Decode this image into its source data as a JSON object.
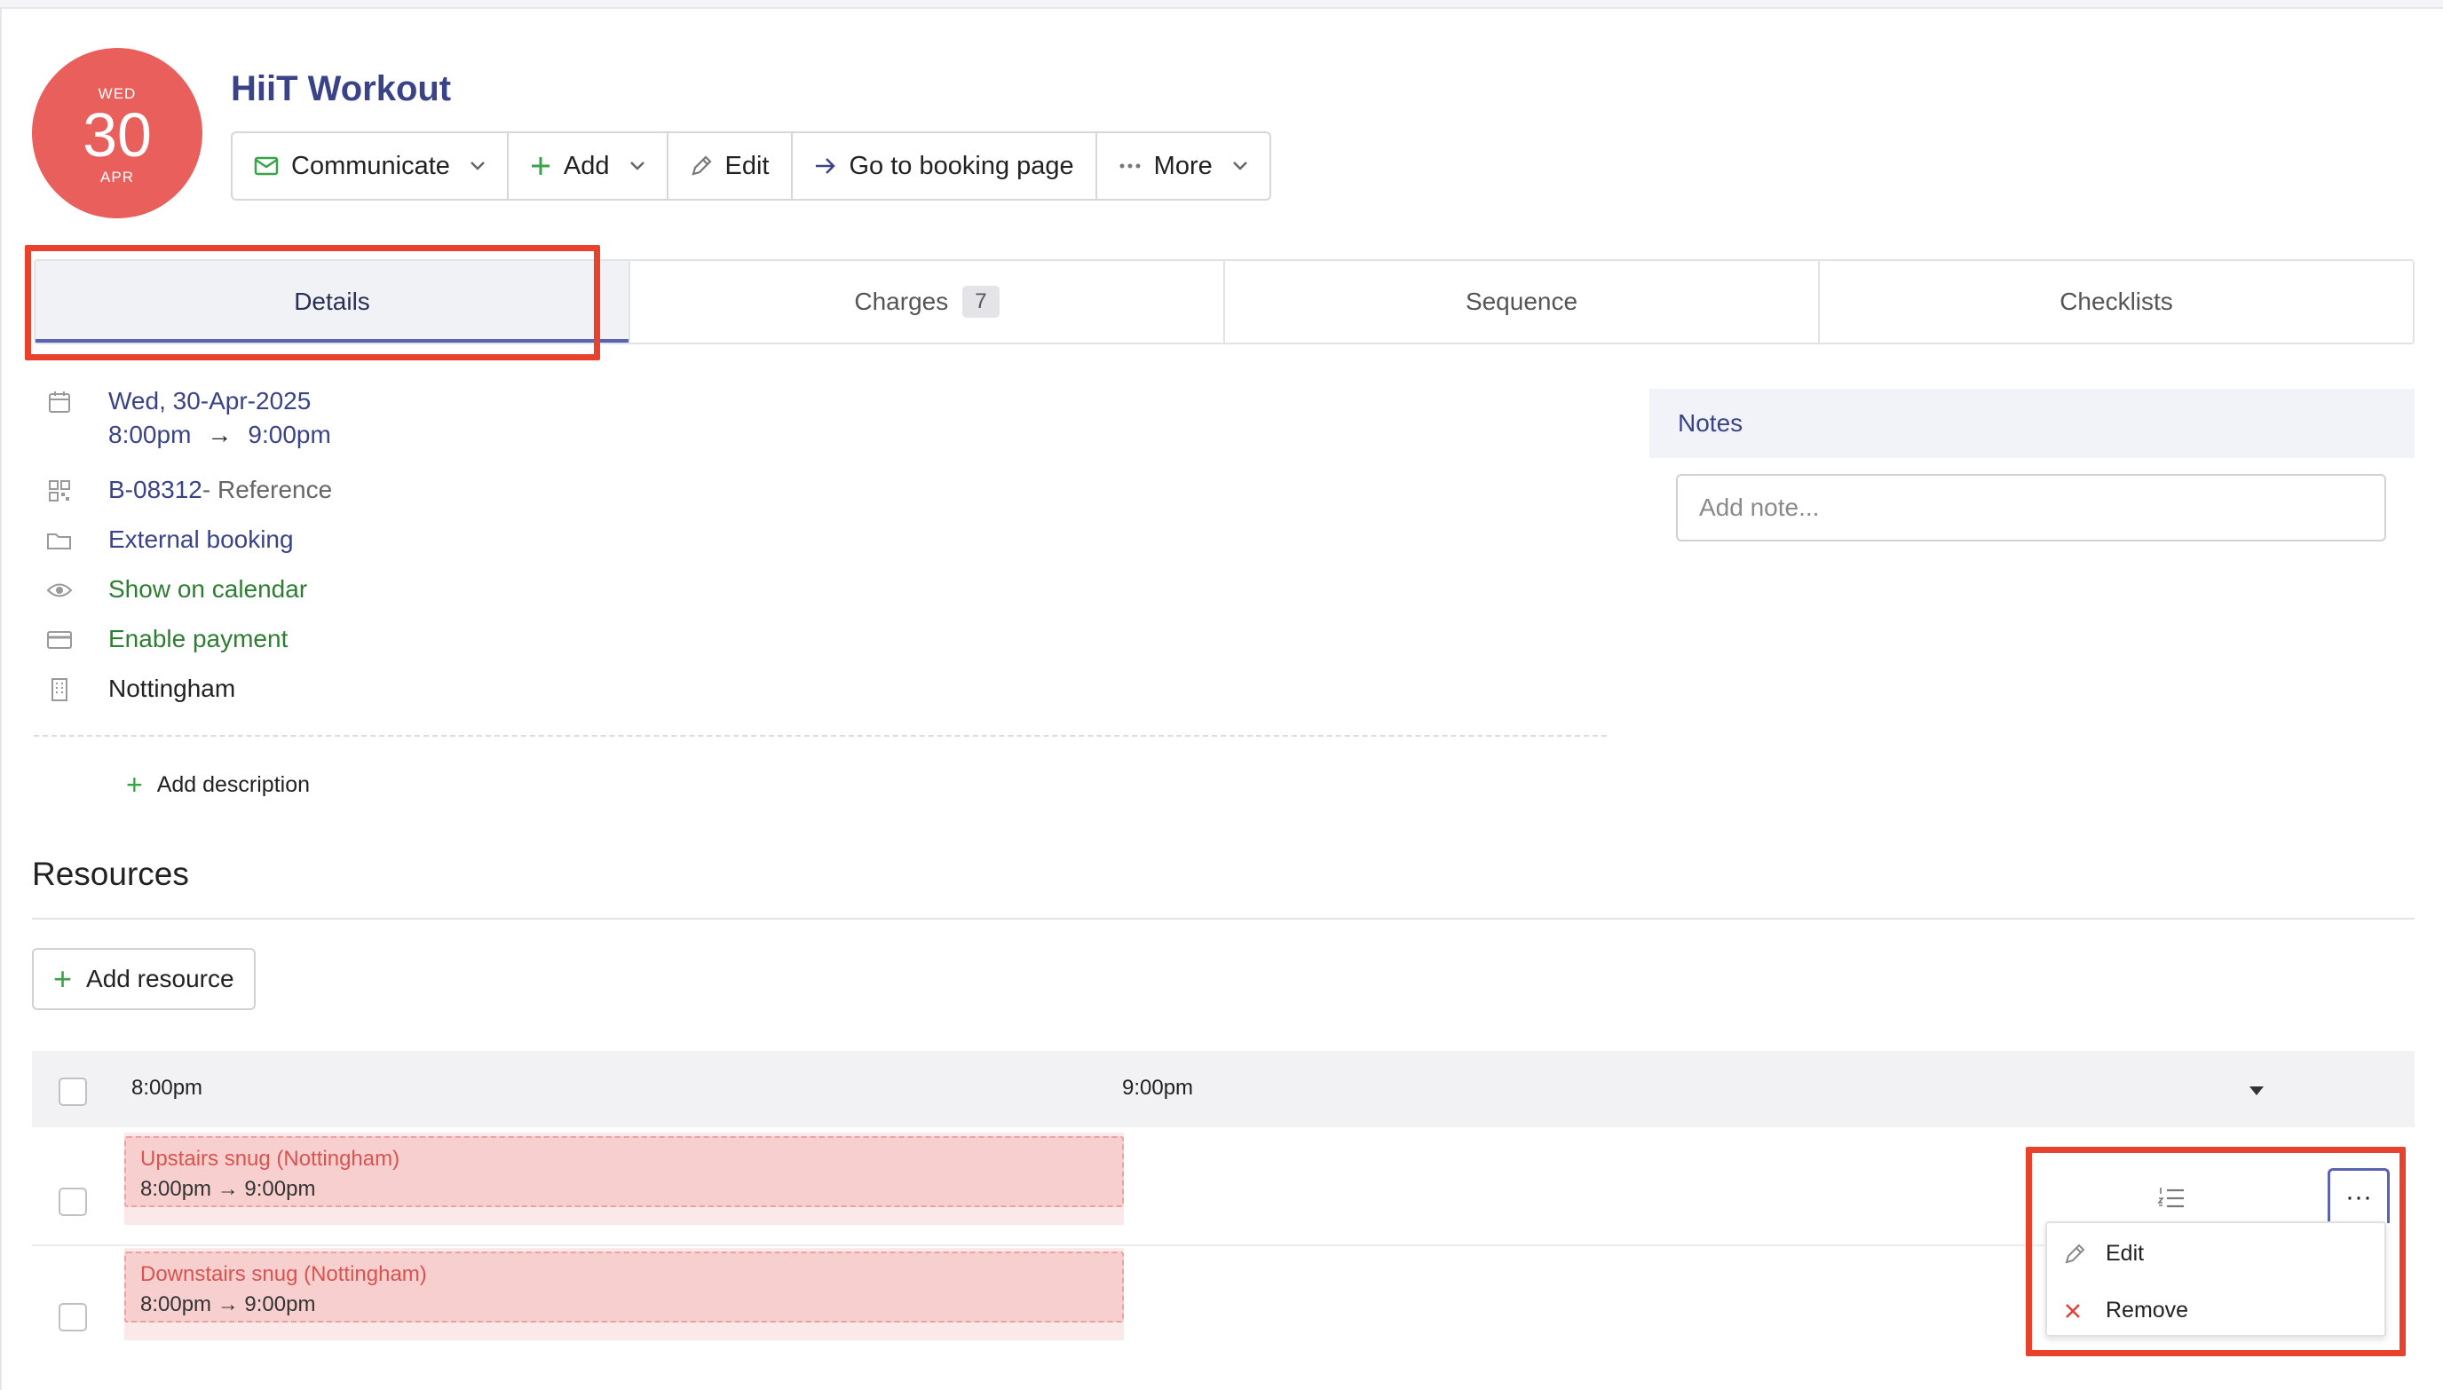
{
  "header": {
    "date_badge": {
      "weekday": "WED",
      "day": "30",
      "month": "APR"
    },
    "title": "HiiT Workout"
  },
  "toolbar": {
    "communicate": "Communicate",
    "add": "Add",
    "edit": "Edit",
    "go_to_booking": "Go to booking page",
    "more": "More"
  },
  "tabs": [
    {
      "label": "Details",
      "active": true
    },
    {
      "label": "Charges",
      "count": "7"
    },
    {
      "label": "Sequence"
    },
    {
      "label": "Checklists"
    }
  ],
  "details": {
    "date": "Wed, 30-Apr-2025",
    "start_time": "8:00pm",
    "arrow": "→",
    "end_time": "9:00pm",
    "reference_code": "B-08312",
    "reference_suffix": " - Reference",
    "booking_type": "External booking",
    "calendar_visibility": "Show on calendar",
    "payment": "Enable payment",
    "location": "Nottingham",
    "add_description": "Add description"
  },
  "notes": {
    "title": "Notes",
    "placeholder": "Add note..."
  },
  "resources": {
    "title": "Resources",
    "add_button": "Add resource",
    "timeline_start": "8:00pm",
    "timeline_end": "9:00pm",
    "items": [
      {
        "name": "Upstairs snug (Nottingham)",
        "time": "8:00pm → 9:00pm"
      },
      {
        "name": "Downstairs snug (Nottingham)",
        "time": "8:00pm → 9:00pm"
      }
    ]
  },
  "action_menu": {
    "trigger": "···",
    "items": [
      {
        "label": "Edit",
        "icon": "pencil-icon"
      },
      {
        "label": "Remove",
        "icon": "close-icon"
      }
    ]
  },
  "colors": {
    "badge": "#e85f5c",
    "title": "#3a4388",
    "green": "#2d7d32",
    "highlight": "#e8412c",
    "slot": "#f7cfcf"
  }
}
